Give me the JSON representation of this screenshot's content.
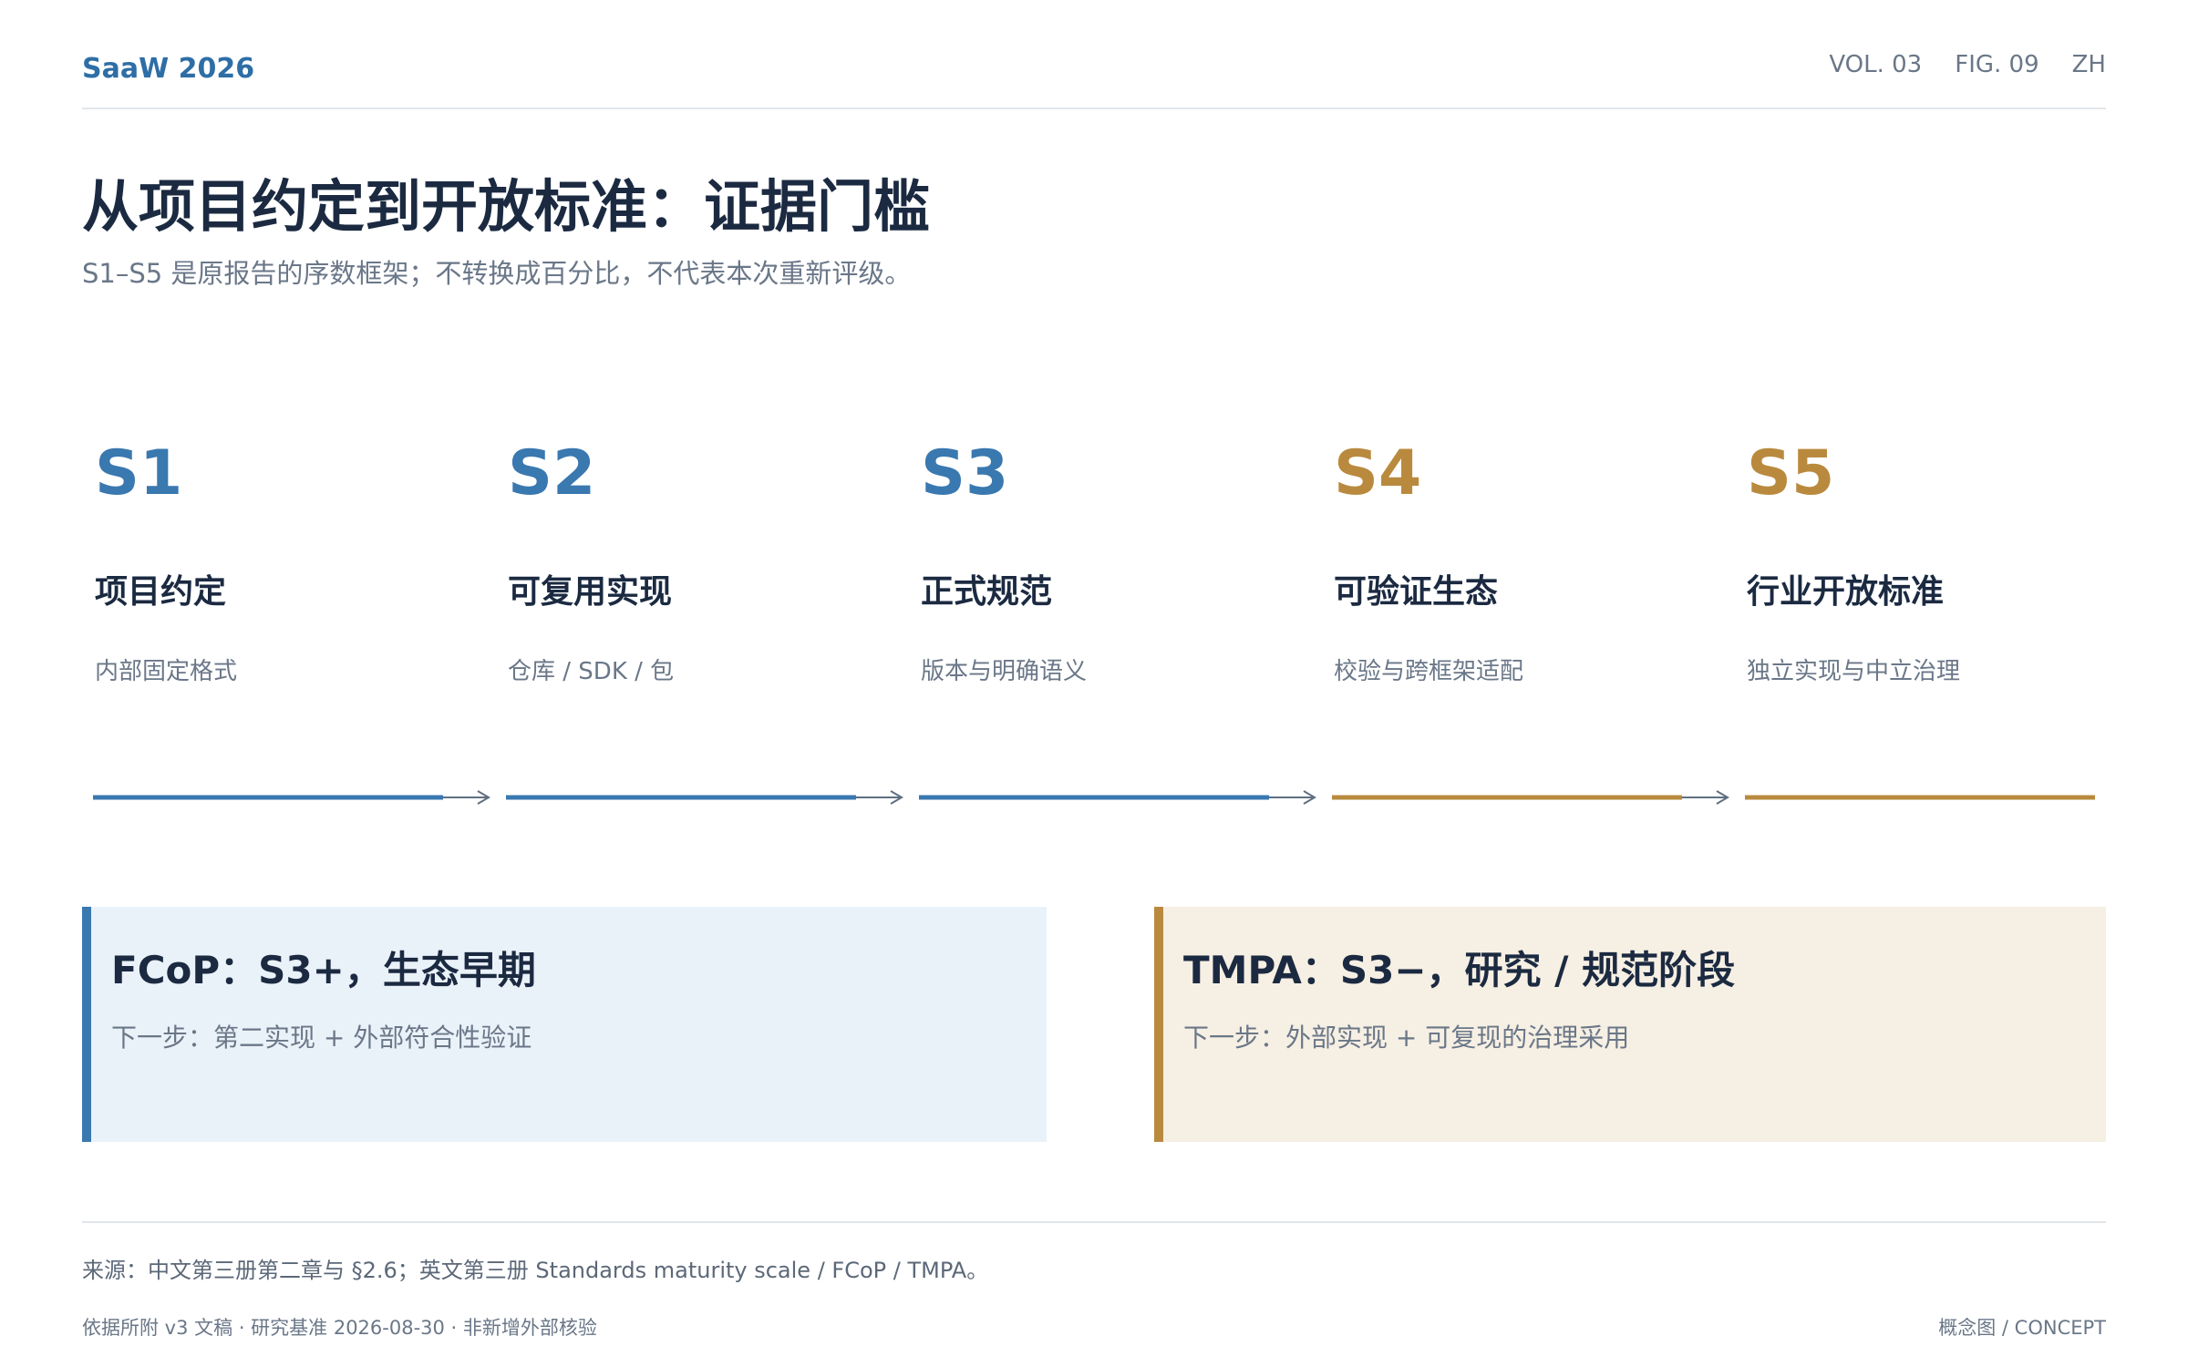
{
  "header": {
    "brand": "SaaW 2026",
    "volume": "VOL. 03",
    "figure": "FIG. 09",
    "language": "ZH"
  },
  "title": "从项目约定到开放标准：证据门槛",
  "subtitle": "S1–S5 是原报告的序数框架；不转换成百分比，不代表本次重新评级。",
  "colors": {
    "blue": "#3a78b0",
    "gold": "#b98a3e",
    "text": "#1b2a41",
    "muted": "#6a7788"
  },
  "stages": [
    {
      "code": "S1",
      "name": "项目约定",
      "desc": "内部固定格式",
      "tone": "blue"
    },
    {
      "code": "S2",
      "name": "可复用实现",
      "desc": "仓库 / SDK / 包",
      "tone": "blue"
    },
    {
      "code": "S3",
      "name": "正式规范",
      "desc": "版本与明确语义",
      "tone": "blue"
    },
    {
      "code": "S4",
      "name": "可验证生态",
      "desc": "校验与跨框架适配",
      "tone": "gold"
    },
    {
      "code": "S5",
      "name": "行业开放标准",
      "desc": "独立实现与中立治理",
      "tone": "gold"
    }
  ],
  "cards": [
    {
      "title": "FCoP：S3+，生态早期",
      "next": "下一步：第二实现 + 外部符合性验证",
      "tone": "blue"
    },
    {
      "title": "TMPA：S3−，研究 / 规范阶段",
      "next": "下一步：外部实现 + 可复现的治理采用",
      "tone": "gold"
    }
  ],
  "footer": {
    "source": "来源：中文第三册第二章与 §2.6；英文第三册 Standards maturity scale / FCoP / TMPA。",
    "basis": "依据所附 v3 文稿 · 研究基准 2026-08-30 · 非新增外部核验",
    "label": "概念图 / CONCEPT"
  }
}
